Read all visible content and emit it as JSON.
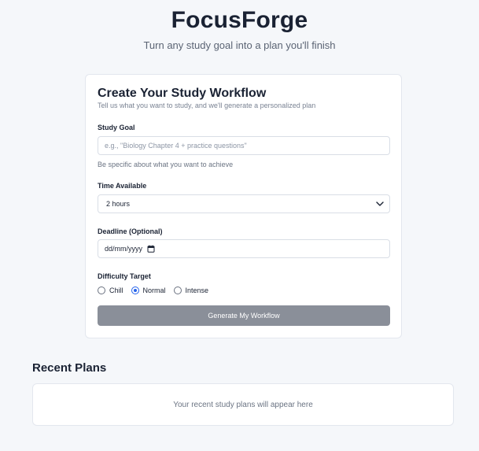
{
  "header": {
    "app_title": "FocusForge",
    "tagline": "Turn any study goal into a plan you'll finish"
  },
  "form": {
    "title": "Create Your Study Workflow",
    "subtitle": "Tell us what you want to study, and we'll generate a personalized plan",
    "study_goal": {
      "label": "Study Goal",
      "placeholder": "e.g., \"Biology Chapter 4 + practice questions\"",
      "value": "",
      "helper": "Be specific about what you want to achieve"
    },
    "time_available": {
      "label": "Time Available",
      "selected": "2 hours",
      "icon": "chevron-down-icon"
    },
    "deadline": {
      "label": "Deadline (Optional)",
      "value": "dd/mm/yyyy",
      "icon": "calendar-icon"
    },
    "difficulty": {
      "label": "Difficulty Target",
      "options": [
        {
          "label": "Chill",
          "checked": false
        },
        {
          "label": "Normal",
          "checked": true
        },
        {
          "label": "Intense",
          "checked": false
        }
      ]
    },
    "submit_label": "Generate My Workflow"
  },
  "recent": {
    "title": "Recent Plans",
    "empty_text": "Your recent study plans will appear here"
  },
  "colors": {
    "background": "#f5f7fa",
    "accent": "#2563eb",
    "button_disabled": "#8a8f99"
  }
}
